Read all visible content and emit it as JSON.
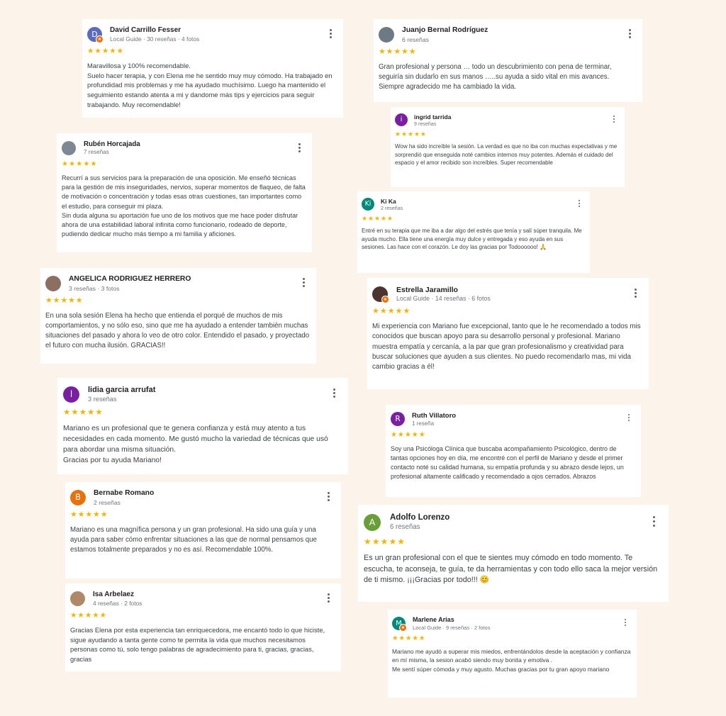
{
  "reviews": [
    {
      "name": "David Carrillo Fesser",
      "meta": "Local Guide · 30 reseñas · 4 fotos",
      "stars": "★★★★★",
      "avatar_letter": "D",
      "avatar_color": "#5c6bc0",
      "text": "Maravillosa y 100% recomendable.\nSuelo hacer terapia, y con Elena me he sentido muy muy cómodo. Ha trabajado en profundidad mis problemas y me ha ayudado muchísimo. Luego ha mantenido el seguimiento estando atenta a mi y dandome más tips y ejercicios para seguir trabajando. Muy recomendable!"
    },
    {
      "name": "Juanjo Bernal Rodríguez",
      "meta": "6 reseñas",
      "stars": "★★★★★",
      "avatar_letter": "",
      "avatar_color": "#6b7a85",
      "text": "Gran profesional y persona … todo un descubrimiento con pena de terminar, seguiría sin dudarlo en sus manos …..su ayuda a sido vital en mis avances. Siempre agradecido me ha cambiado la vida."
    },
    {
      "name": "ingrid tarrida",
      "meta": "9 reseñas",
      "stars": "★★★★★",
      "avatar_letter": "i",
      "avatar_color": "#7b1fa2",
      "text": "Wow ha sido increíble la sesión. La verdad es que no iba con muchas expectativas y me sorprendió que enseguida noté cambios internos muy potentes. Además el cuidado del espacio y el amor recibido son increíbles. Super recomendable"
    },
    {
      "name": "Rubén Horcajada",
      "meta": "7 reseñas",
      "stars": "★★★★★",
      "avatar_letter": "",
      "avatar_color": "#7d8894",
      "text": "Recurrí a sus servicios para la preparación de una oposición. Me enseñó técnicas para la gestión de mis inseguridades, nervios, superar momentos de flaqueo, de falta de motivación o concentración y todas esas otras cuestiones, tan importantes como el estudio, para conseguir mi plaza.\nSin duda alguna su aportación fue uno de los motivos que me hace poder disfrutar ahora de una estabilidad laboral infinita como funcionario, rodeado de deporte, pudiendo dedicar mucho más tiempo a mi familia y aficiones."
    },
    {
      "name": "Ki Ka",
      "meta": "2 reseñas",
      "stars": "★★★★★",
      "avatar_letter": "Ki",
      "avatar_color": "#00897b",
      "text": "Entré en su terapia que me iba a dar algo del estrés que tenía y salí súper tranquila. Me ayuda mucho. Ella tiene una energía muy dulce y entregada y eso ayuda en sus sesiones. Las hace con el corazón. Le doy las gracias por Todoooooo! 🙏"
    },
    {
      "name": "ANGELICA RODRIGUEZ HERRERO",
      "meta": "3 reseñas · 3 fotos",
      "stars": "★★★★★",
      "avatar_letter": "",
      "avatar_color": "#8d6e63",
      "text": "En una sola sesión Elena ha hecho que entienda el porqué de muchos de mis comportamientos, y no sólo eso, sino que me ha ayudado a entender también muchas situaciones del pasado y ahora lo veo de otro color. Entendido el pasado, y proyectado el futuro con mucha ilusión. GRACIAS!!"
    },
    {
      "name": "Estrella Jaramillo",
      "meta": "Local Guide · 14 reseñas · 6 fotos",
      "stars": "★★★★★",
      "avatar_letter": "",
      "avatar_color": "#4e342e",
      "text": "Mi experiencia con Mariano fue excepcional, tanto que le he recomendado a todos mis conocidos que buscan apoyo para su desarrollo personal y profesional. Mariano muestra empatía y cercanía, a la par que gran profesionalismo y creatividad para buscar soluciones que ayuden a sus clientes. No puedo recomendarlo mas, mi vida cambio gracias a él!"
    },
    {
      "name": "lidia garcia arrufat",
      "meta": "3 reseñas",
      "stars": "★★★★★",
      "avatar_letter": "l",
      "avatar_color": "#7b1fa2",
      "text": "Mariano es un profesional que te genera confianza y está muy atento a tus necesidades en cada momento. Me gustó mucho la variedad de técnicas que usó para abordar una misma situación.\nGracias por tu ayuda Mariano!"
    },
    {
      "name": "Ruth Villatoro",
      "meta": "1 reseña",
      "stars": "★★★★★",
      "avatar_letter": "R",
      "avatar_color": "#7b1fa2",
      "text": "Soy una Psicóloga Clínica que buscaba acompañamiento Psicológico, dentro de tantas opciones hoy en día, me encontré con el perfil de Mariano y desde el primer contacto noté su calidad humana, su empatía profunda y su abrazo desde lejos, un profesional altamente calificado y recomendado a ojos cerrados. Abrazos"
    },
    {
      "name": "Bernabe Romano",
      "meta": "2 reseñas",
      "stars": "★★★★★",
      "avatar_letter": "B",
      "avatar_color": "#e8710a",
      "text": "Mariano es una magnífica persona y un gran profesional. Ha sido una guía y una ayuda para saber cómo enfrentar situaciones a las que de normal pensamos que estamos totalmente preparados y no es así. Recomendable 100%."
    },
    {
      "name": "Adolfo Lorenzo",
      "meta": "6 reseñas",
      "stars": "★★★★★",
      "avatar_letter": "A",
      "avatar_color": "#689f38",
      "text": "Es un gran profesional con el que te sientes muy cómodo en todo momento. Te escucha, te aconseja, te guía, te da herramientas y con todo ello saca la mejor versión de ti mismo. ¡¡¡Gracias por todo!!! 😊"
    },
    {
      "name": "Isa Arbelaez",
      "meta": "4 reseñas · 2 fotos",
      "stars": "★★★★★",
      "avatar_letter": "",
      "avatar_color": "#b08968",
      "text": "Gracias Elena por esta experiencia tan enriquecedora, me encantó todo lo que hiciste, sigue ayudando a tanta gente como te permita la vida que muchos necesitamos personas como tú, solo tengo palabras de agradecimiento para ti, gracias, gracias, gracias"
    },
    {
      "name": "Marlene Arias",
      "meta": "Local Guide · 9 reseñas · 2 fotos",
      "stars": "★★★★★",
      "avatar_letter": "M",
      "avatar_color": "#00897b",
      "text": "Mariano me ayudó a superar mis miedos, enfrentándolos desde la aceptación y confianza en mí misma, la sesion acabó siendo muy bonita y emotiva .\nMe sentí súper cómoda y muy agusto. Muchas gracias por tu gran apoyo mariano"
    }
  ]
}
